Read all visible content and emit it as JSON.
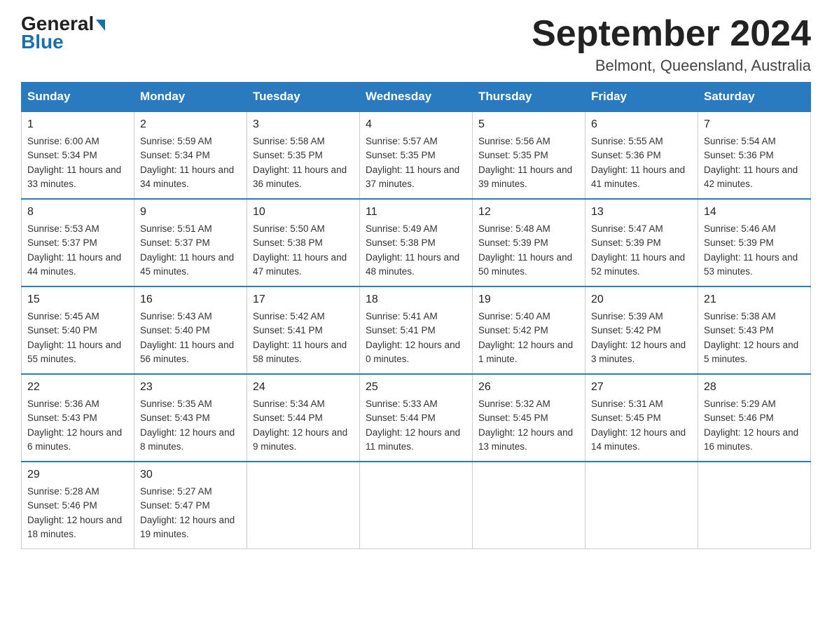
{
  "header": {
    "logo_general": "General",
    "logo_blue": "Blue",
    "month_title": "September 2024",
    "location": "Belmont, Queensland, Australia"
  },
  "days_of_week": [
    "Sunday",
    "Monday",
    "Tuesday",
    "Wednesday",
    "Thursday",
    "Friday",
    "Saturday"
  ],
  "weeks": [
    [
      {
        "day": "1",
        "sunrise": "6:00 AM",
        "sunset": "5:34 PM",
        "daylight": "11 hours and 33 minutes."
      },
      {
        "day": "2",
        "sunrise": "5:59 AM",
        "sunset": "5:34 PM",
        "daylight": "11 hours and 34 minutes."
      },
      {
        "day": "3",
        "sunrise": "5:58 AM",
        "sunset": "5:35 PM",
        "daylight": "11 hours and 36 minutes."
      },
      {
        "day": "4",
        "sunrise": "5:57 AM",
        "sunset": "5:35 PM",
        "daylight": "11 hours and 37 minutes."
      },
      {
        "day": "5",
        "sunrise": "5:56 AM",
        "sunset": "5:35 PM",
        "daylight": "11 hours and 39 minutes."
      },
      {
        "day": "6",
        "sunrise": "5:55 AM",
        "sunset": "5:36 PM",
        "daylight": "11 hours and 41 minutes."
      },
      {
        "day": "7",
        "sunrise": "5:54 AM",
        "sunset": "5:36 PM",
        "daylight": "11 hours and 42 minutes."
      }
    ],
    [
      {
        "day": "8",
        "sunrise": "5:53 AM",
        "sunset": "5:37 PM",
        "daylight": "11 hours and 44 minutes."
      },
      {
        "day": "9",
        "sunrise": "5:51 AM",
        "sunset": "5:37 PM",
        "daylight": "11 hours and 45 minutes."
      },
      {
        "day": "10",
        "sunrise": "5:50 AM",
        "sunset": "5:38 PM",
        "daylight": "11 hours and 47 minutes."
      },
      {
        "day": "11",
        "sunrise": "5:49 AM",
        "sunset": "5:38 PM",
        "daylight": "11 hours and 48 minutes."
      },
      {
        "day": "12",
        "sunrise": "5:48 AM",
        "sunset": "5:39 PM",
        "daylight": "11 hours and 50 minutes."
      },
      {
        "day": "13",
        "sunrise": "5:47 AM",
        "sunset": "5:39 PM",
        "daylight": "11 hours and 52 minutes."
      },
      {
        "day": "14",
        "sunrise": "5:46 AM",
        "sunset": "5:39 PM",
        "daylight": "11 hours and 53 minutes."
      }
    ],
    [
      {
        "day": "15",
        "sunrise": "5:45 AM",
        "sunset": "5:40 PM",
        "daylight": "11 hours and 55 minutes."
      },
      {
        "day": "16",
        "sunrise": "5:43 AM",
        "sunset": "5:40 PM",
        "daylight": "11 hours and 56 minutes."
      },
      {
        "day": "17",
        "sunrise": "5:42 AM",
        "sunset": "5:41 PM",
        "daylight": "11 hours and 58 minutes."
      },
      {
        "day": "18",
        "sunrise": "5:41 AM",
        "sunset": "5:41 PM",
        "daylight": "12 hours and 0 minutes."
      },
      {
        "day": "19",
        "sunrise": "5:40 AM",
        "sunset": "5:42 PM",
        "daylight": "12 hours and 1 minute."
      },
      {
        "day": "20",
        "sunrise": "5:39 AM",
        "sunset": "5:42 PM",
        "daylight": "12 hours and 3 minutes."
      },
      {
        "day": "21",
        "sunrise": "5:38 AM",
        "sunset": "5:43 PM",
        "daylight": "12 hours and 5 minutes."
      }
    ],
    [
      {
        "day": "22",
        "sunrise": "5:36 AM",
        "sunset": "5:43 PM",
        "daylight": "12 hours and 6 minutes."
      },
      {
        "day": "23",
        "sunrise": "5:35 AM",
        "sunset": "5:43 PM",
        "daylight": "12 hours and 8 minutes."
      },
      {
        "day": "24",
        "sunrise": "5:34 AM",
        "sunset": "5:44 PM",
        "daylight": "12 hours and 9 minutes."
      },
      {
        "day": "25",
        "sunrise": "5:33 AM",
        "sunset": "5:44 PM",
        "daylight": "12 hours and 11 minutes."
      },
      {
        "day": "26",
        "sunrise": "5:32 AM",
        "sunset": "5:45 PM",
        "daylight": "12 hours and 13 minutes."
      },
      {
        "day": "27",
        "sunrise": "5:31 AM",
        "sunset": "5:45 PM",
        "daylight": "12 hours and 14 minutes."
      },
      {
        "day": "28",
        "sunrise": "5:29 AM",
        "sunset": "5:46 PM",
        "daylight": "12 hours and 16 minutes."
      }
    ],
    [
      {
        "day": "29",
        "sunrise": "5:28 AM",
        "sunset": "5:46 PM",
        "daylight": "12 hours and 18 minutes."
      },
      {
        "day": "30",
        "sunrise": "5:27 AM",
        "sunset": "5:47 PM",
        "daylight": "12 hours and 19 minutes."
      },
      null,
      null,
      null,
      null,
      null
    ]
  ]
}
